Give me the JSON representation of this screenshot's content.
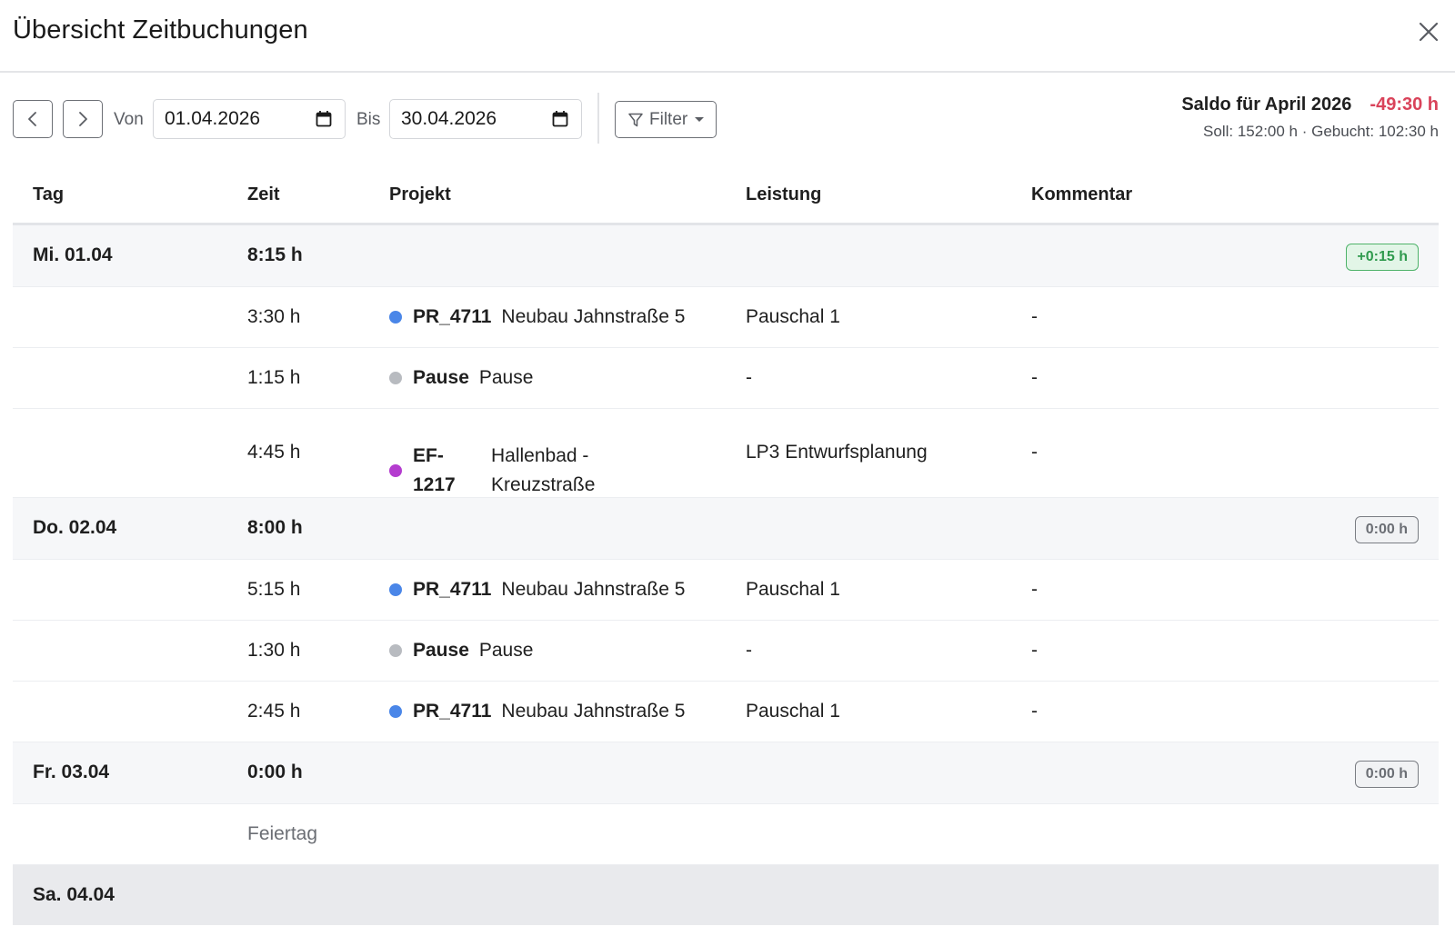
{
  "title": "Übersicht Zeitbuchungen",
  "toolbar": {
    "von_label": "Von",
    "von_value": "01.04.2026",
    "bis_label": "Bis",
    "bis_value": "30.04.2026",
    "filter_label": "Filter"
  },
  "saldo": {
    "label": "Saldo für April 2026",
    "value": "-49:30 h",
    "details": "Soll: 152:00 h · Gebucht: 102:30 h"
  },
  "columns": {
    "tag": "Tag",
    "zeit": "Zeit",
    "projekt": "Projekt",
    "leistung": "Leistung",
    "kommentar": "Kommentar"
  },
  "colors": {
    "blue": "#4a86e8",
    "gray": "#b8bbc0",
    "purple": "#b43ccf",
    "negative": "#d9435a",
    "positive": "#2f9a4d"
  },
  "days": [
    {
      "tag": "Mi. 01.04",
      "total": "8:15 h",
      "badge": "+0:15 h",
      "entries": [
        {
          "zeit": "3:30 h",
          "code": "PR_4711",
          "name": "Neubau Jahnstraße 5",
          "leistung": "Pauschal 1",
          "kommentar": "-"
        },
        {
          "zeit": "1:15 h",
          "code": "Pause",
          "name": "Pause",
          "leistung": "-",
          "kommentar": "-"
        },
        {
          "zeit": "4:45 h",
          "code_line1": "EF-",
          "code_line2": "1217",
          "name_line1": "Hallenbad -",
          "name_line2": "Kreuzstraße",
          "leistung": "LP3 Entwurfsplanung",
          "kommentar": "-"
        }
      ]
    },
    {
      "tag": "Do. 02.04",
      "total": "8:00 h",
      "badge": "0:00 h",
      "entries": [
        {
          "zeit": "5:15 h",
          "code": "PR_4711",
          "name": "Neubau Jahnstraße 5",
          "leistung": "Pauschal 1",
          "kommentar": "-"
        },
        {
          "zeit": "1:30 h",
          "code": "Pause",
          "name": "Pause",
          "leistung": "-",
          "kommentar": "-"
        },
        {
          "zeit": "2:45 h",
          "code": "PR_4711",
          "name": "Neubau Jahnstraße 5",
          "leistung": "Pauschal 1",
          "kommentar": "-"
        }
      ]
    },
    {
      "tag": "Fr. 03.04",
      "total": "0:00 h",
      "badge": "0:00 h",
      "note": "Feiertag"
    },
    {
      "tag": "Sa. 04.04"
    }
  ]
}
